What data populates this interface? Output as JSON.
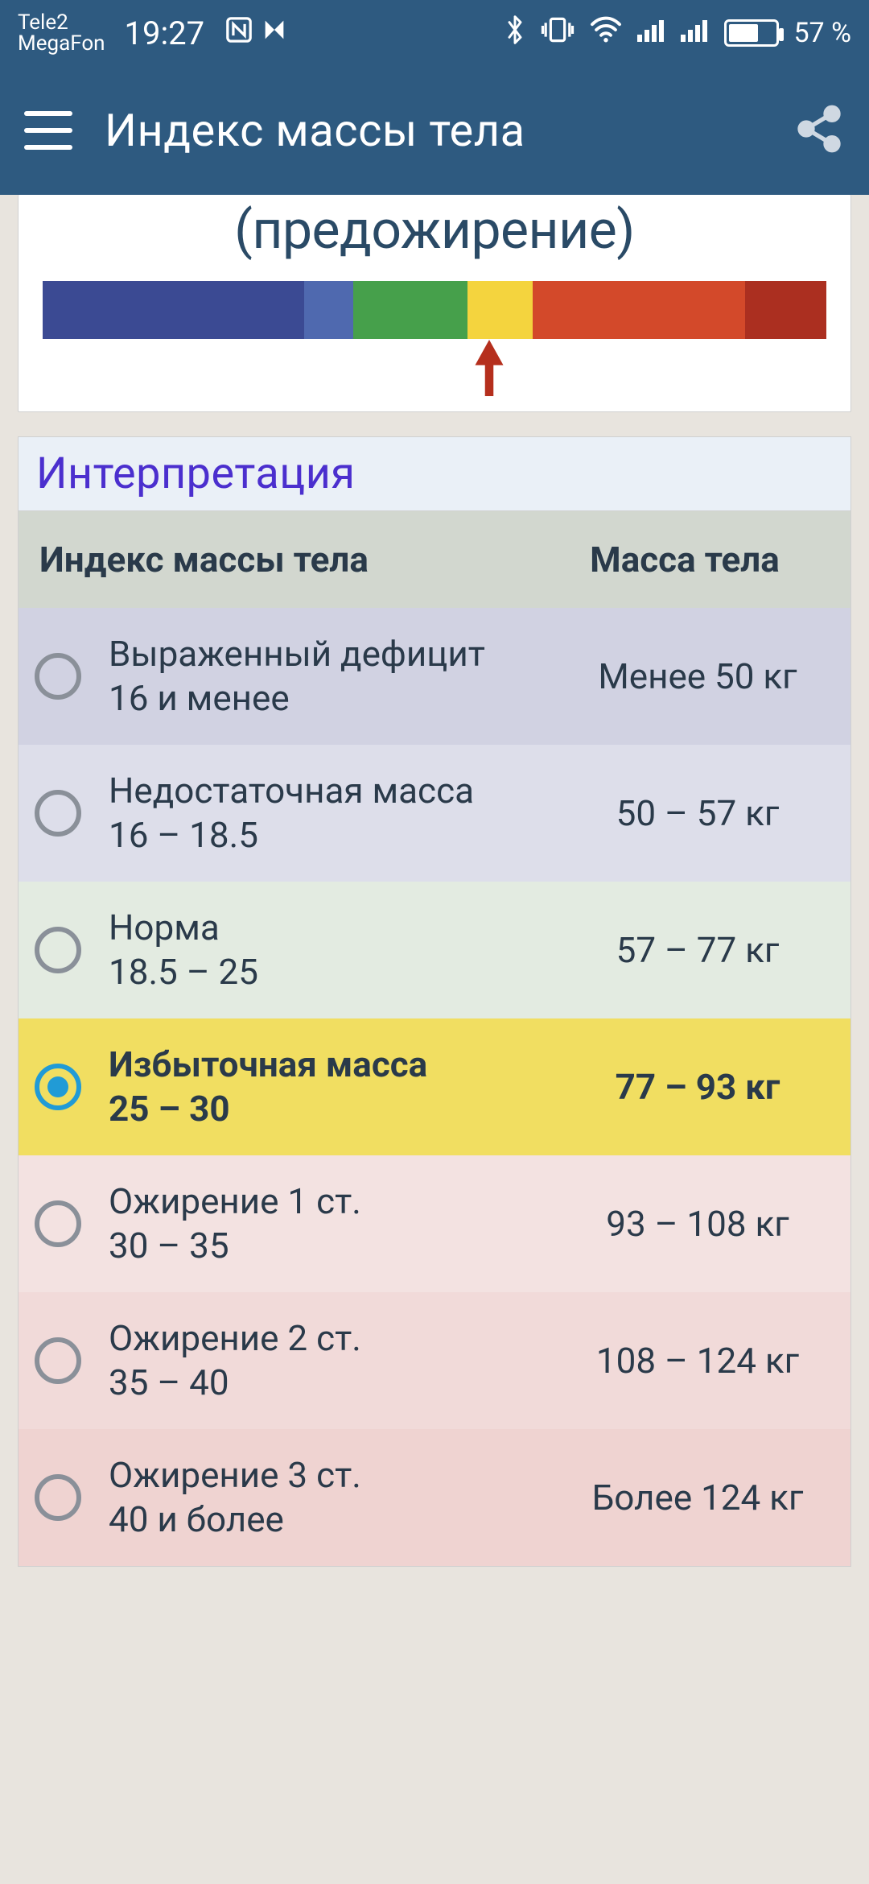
{
  "status": {
    "carrier1": "Tele2",
    "carrier2": "MegaFon",
    "time": "19:27",
    "battery_text": "57 %"
  },
  "header": {
    "title": "Индекс массы тела"
  },
  "result": {
    "label": "(предожирение)"
  },
  "scale": {
    "segments": [
      {
        "color": "#3b4a93",
        "flex": 32
      },
      {
        "color": "#4f69af",
        "flex": 6
      },
      {
        "color": "#46a04b",
        "flex": 14
      },
      {
        "color": "#f4d43e",
        "flex": 8
      },
      {
        "color": "#d3492a",
        "flex": 26
      },
      {
        "color": "#ab2f20",
        "flex": 10
      }
    ],
    "pointer_percent": 57
  },
  "interpretation": {
    "title": "Интерпретация",
    "col_a": "Индекс массы тела",
    "col_b": "Масса тела",
    "rows": [
      {
        "label": "Выраженный дефицит",
        "range": "16 и менее",
        "mass": "Менее 50 кг",
        "bg": "bg-0",
        "selected": false
      },
      {
        "label": "Недостаточная масса",
        "range": "16 – 18.5",
        "mass": "50 – 57 кг",
        "bg": "bg-1",
        "selected": false
      },
      {
        "label": "Норма",
        "range": "18.5 – 25",
        "mass": "57 – 77 кг",
        "bg": "bg-2",
        "selected": false
      },
      {
        "label": "Избыточная масса",
        "range": "25 – 30",
        "mass": "77 – 93 кг",
        "bg": "bg-3",
        "selected": true
      },
      {
        "label": "Ожирение 1 ст.",
        "range": "30 – 35",
        "mass": "93 – 108 кг",
        "bg": "bg-4",
        "selected": false
      },
      {
        "label": "Ожирение 2 ст.",
        "range": "35 – 40",
        "mass": "108 – 124 кг",
        "bg": "bg-5",
        "selected": false
      },
      {
        "label": "Ожирение 3 ст.",
        "range": "40 и более",
        "mass": "Более 124 кг",
        "bg": "bg-6",
        "selected": false
      }
    ]
  }
}
